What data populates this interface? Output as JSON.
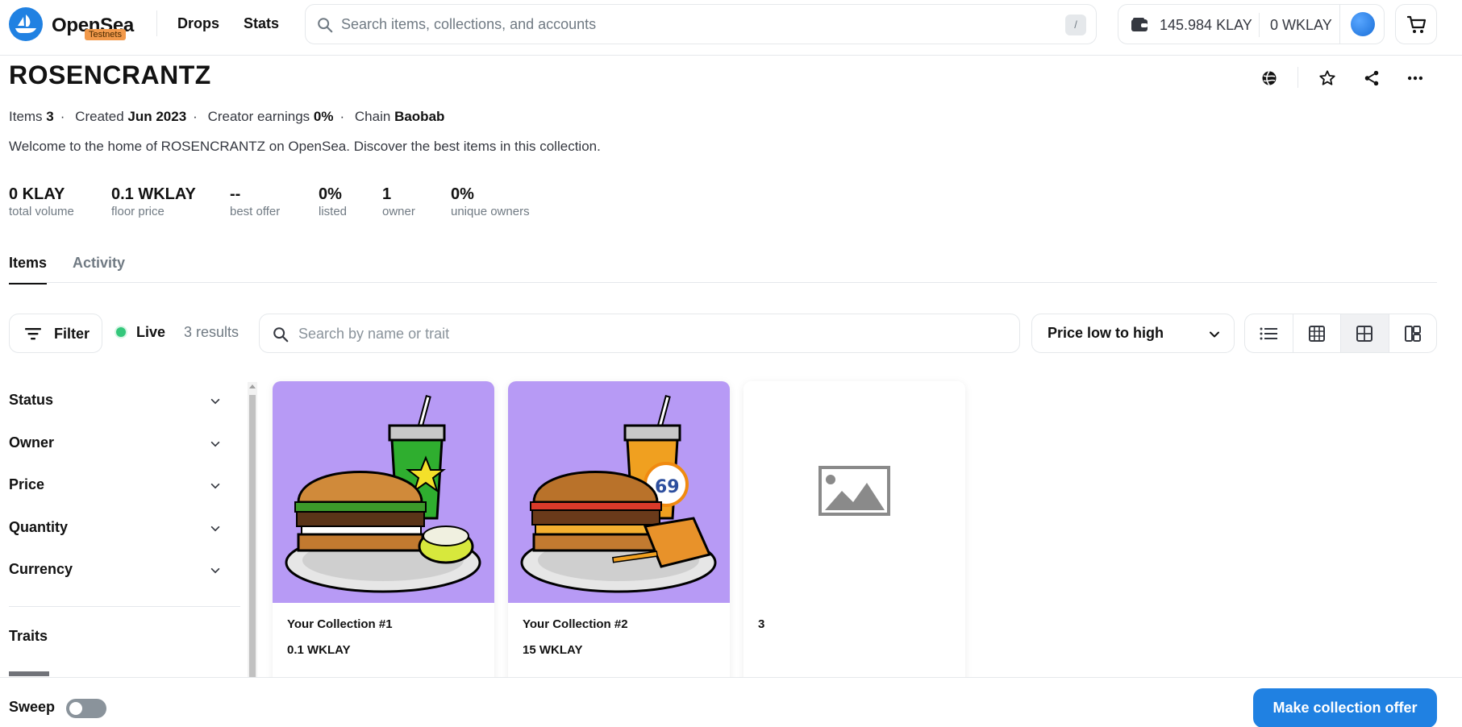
{
  "nav": {
    "brand": "OpenSea",
    "badge": "Testnets",
    "links": [
      "Drops",
      "Stats"
    ],
    "search_placeholder": "Search items, collections, and accounts",
    "search_shortcut": "/",
    "balance_klay": "145.984 KLAY",
    "balance_wklay": "0 WKLAY",
    "brand_color": "#2081e2"
  },
  "collection": {
    "title": "ROSENCRANTZ",
    "meta": {
      "items_label": "Items",
      "items_value": "3",
      "created_label": "Created",
      "created_value": "Jun 2023",
      "earnings_label": "Creator earnings",
      "earnings_value": "0%",
      "chain_label": "Chain",
      "chain_value": "Baobab"
    },
    "description": "Welcome to the home of ROSENCRANTZ on OpenSea. Discover the best items in this collection.",
    "stats": [
      {
        "value": "0 KLAY",
        "label": "total volume"
      },
      {
        "value": "0.1 WKLAY",
        "label": "floor price"
      },
      {
        "value": "--",
        "label": "best offer"
      },
      {
        "value": "0%",
        "label": "listed"
      },
      {
        "value": "1",
        "label": "owner"
      },
      {
        "value": "0%",
        "label": "unique owners"
      }
    ]
  },
  "tabs": [
    "Items",
    "Activity"
  ],
  "toolbar": {
    "filter_label": "Filter",
    "live_label": "Live",
    "results": "3 results",
    "search_placeholder": "Search by name or trait",
    "sort_label": "Price low to high"
  },
  "sidebar": {
    "filters": [
      "Status",
      "Owner",
      "Price",
      "Quantity",
      "Currency"
    ],
    "traits_label": "Traits"
  },
  "items": [
    {
      "name": "Your Collection #1",
      "price": "0.1 WKLAY",
      "image": "burger-green-drink"
    },
    {
      "name": "Your Collection #2",
      "price": "15 WKLAY",
      "image": "burger-orange-drink"
    },
    {
      "name": "3",
      "price": "",
      "image": "placeholder-image-icon"
    }
  ],
  "bottom": {
    "sweep_label": "Sweep",
    "sweep_on": false,
    "offer_button": "Make collection offer"
  }
}
